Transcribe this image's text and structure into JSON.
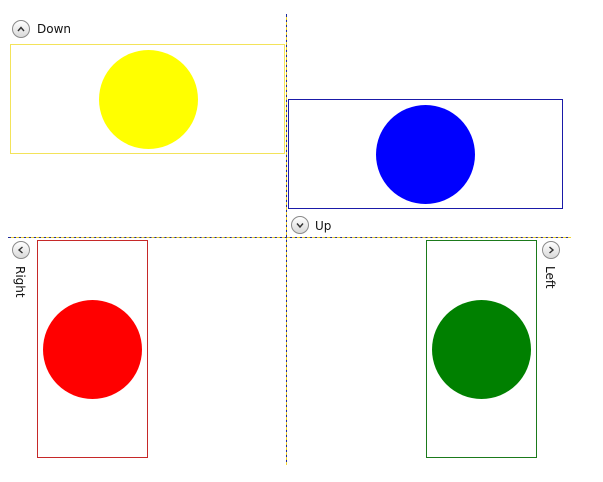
{
  "expanders": [
    {
      "id": "top-left",
      "header": "Down",
      "direction": "down",
      "icon": "chevron-up-icon",
      "panel_border_color": "#f3e35a",
      "circle_color": "#ffff00"
    },
    {
      "id": "top-right",
      "header": "Up",
      "direction": "up",
      "icon": "chevron-down-icon",
      "panel_border_color": "#1a1aa8",
      "circle_color": "#0000ff"
    },
    {
      "id": "bottom-left",
      "header": "Right",
      "direction": "right",
      "icon": "chevron-left-icon",
      "panel_border_color": "#c62828",
      "circle_color": "#ff0000"
    },
    {
      "id": "bottom-right",
      "header": "Left",
      "direction": "left",
      "icon": "chevron-right-icon",
      "panel_border_color": "#1b7a1b",
      "circle_color": "#008000"
    }
  ],
  "grid_splitter_colors": {
    "primary": "#1f2b9b",
    "secondary": "#f2d21b"
  }
}
